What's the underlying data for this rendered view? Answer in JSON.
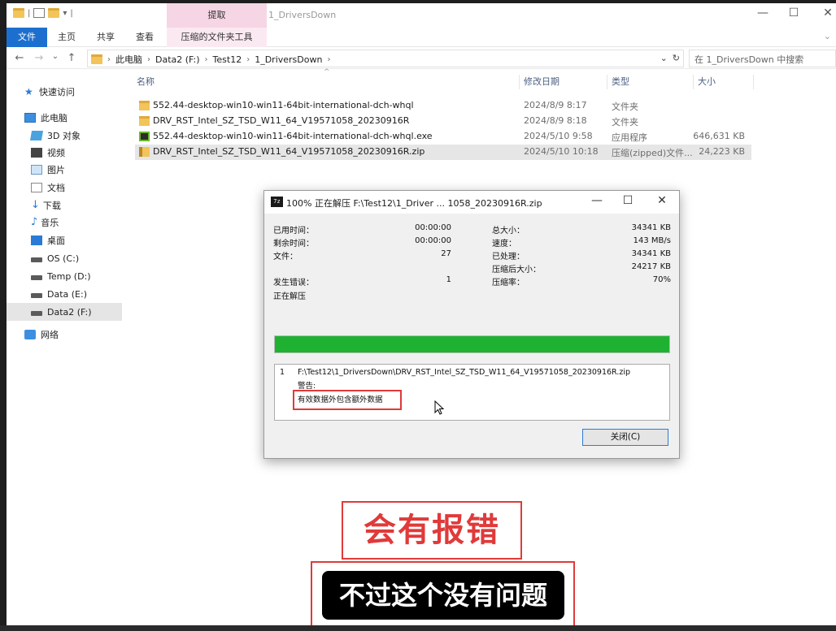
{
  "window": {
    "title": "1_DriversDown",
    "context_tab": "提取",
    "controls": {
      "minimize": "—",
      "maximize": "☐",
      "close": "✕"
    }
  },
  "ribbon": {
    "tabs": [
      "文件",
      "主页",
      "共享",
      "查看"
    ],
    "context_tool": "压缩的文件夹工具",
    "expand": "⌄"
  },
  "address": {
    "crumbs": [
      "此电脑",
      "Data2 (F:)",
      "Test12",
      "1_DriversDown"
    ],
    "search_placeholder": "在 1_DriversDown 中搜索",
    "dropdown": "⌄",
    "refresh": "↻"
  },
  "sidebar": {
    "items": [
      {
        "label": "快速访问",
        "icon": "star-icon"
      },
      {
        "label": "此电脑",
        "icon": "computer-icon"
      },
      {
        "label": "3D 对象",
        "icon": "cube-icon"
      },
      {
        "label": "视频",
        "icon": "video-icon"
      },
      {
        "label": "图片",
        "icon": "picture-icon"
      },
      {
        "label": "文档",
        "icon": "document-icon"
      },
      {
        "label": "下载",
        "icon": "download-icon"
      },
      {
        "label": "音乐",
        "icon": "music-icon"
      },
      {
        "label": "桌面",
        "icon": "desktop-icon"
      },
      {
        "label": "OS (C:)",
        "icon": "drive-icon"
      },
      {
        "label": "Temp (D:)",
        "icon": "drive-icon"
      },
      {
        "label": "Data (E:)",
        "icon": "drive-icon"
      },
      {
        "label": "Data2 (F:)",
        "icon": "drive-icon"
      },
      {
        "label": "网络",
        "icon": "network-icon"
      }
    ]
  },
  "filelist": {
    "columns": {
      "name": "名称",
      "date": "修改日期",
      "type": "类型",
      "size": "大小"
    },
    "rows": [
      {
        "name": "552.44-desktop-win10-win11-64bit-international-dch-whql",
        "date": "2024/8/9 8:17",
        "type": "文件夹",
        "size": "",
        "icon": "folder-icon"
      },
      {
        "name": "DRV_RST_Intel_SZ_TSD_W11_64_V19571058_20230916R",
        "date": "2024/8/9 8:18",
        "type": "文件夹",
        "size": "",
        "icon": "folder-icon"
      },
      {
        "name": "552.44-desktop-win10-win11-64bit-international-dch-whql.exe",
        "date": "2024/5/10 9:58",
        "type": "应用程序",
        "size": "646,631 KB",
        "icon": "nvidia-exe-icon"
      },
      {
        "name": "DRV_RST_Intel_SZ_TSD_W11_64_V19571058_20230916R.zip",
        "date": "2024/5/10 10:18",
        "type": "压缩(zipped)文件...",
        "size": "24,223 KB",
        "icon": "zip-icon"
      }
    ]
  },
  "dialog": {
    "title": "100% 正在解压 F:\\Test12\\1_Driver ... 1058_20230916R.zip",
    "icon_text": "7z",
    "labels": {
      "elapsed": "已用时间：",
      "remaining": "剩余时间：",
      "files": "文件：",
      "total": "总大小：",
      "speed": "速度：",
      "processed": "已处理：",
      "compressed": "压缩后大小：",
      "ratio": "压缩率：",
      "errors": "发生错误：",
      "status": "正在解压"
    },
    "values": {
      "elapsed": "00:00:00",
      "remaining": "00:00:00",
      "files": "27",
      "total": "34341 KB",
      "speed": "143 MB/s",
      "processed": "34341 KB",
      "compressed": "24217 KB",
      "ratio": "70%",
      "errors": "1"
    },
    "progress": 1.0,
    "progress_color": "#1fb232",
    "messages": {
      "index": "1",
      "path": "F:\\Test12\\1_DriversDown\\DRV_RST_Intel_SZ_TSD_W11_64_V19571058_20230916R.zip",
      "warning_label": "警告:",
      "warning_text": "有效数据外包含额外数据"
    },
    "close_button": "关闭(C)"
  },
  "captions": {
    "red": "会有报错",
    "black": "不过这个没有问题"
  },
  "colors": {
    "accent": "#1d6fcf",
    "highlight_red": "#e03a3a",
    "context_tab": "#f6d5e4"
  }
}
